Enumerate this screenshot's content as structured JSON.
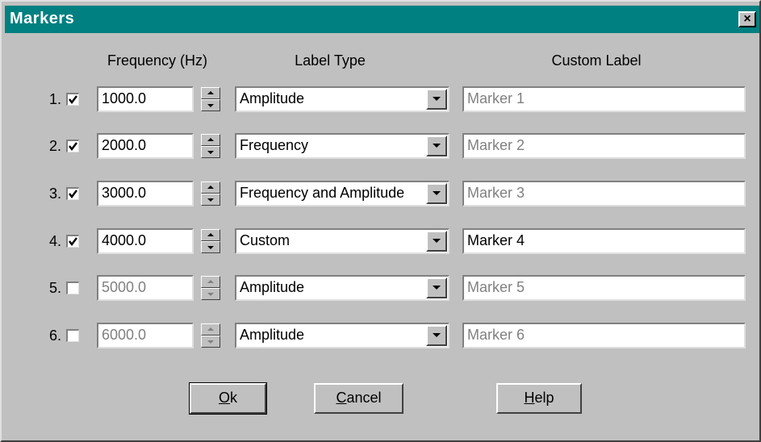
{
  "window": {
    "title": "Markers",
    "close_glyph": "×"
  },
  "columns": {
    "frequency": "Frequency (Hz)",
    "label_type": "Label Type",
    "custom_label": "Custom Label"
  },
  "rows": [
    {
      "number": "1.",
      "checked": true,
      "frequency": "1000.0",
      "label_type": "Amplitude",
      "custom_label": "Marker 1",
      "label_enabled": false,
      "freq_enabled": true
    },
    {
      "number": "2.",
      "checked": true,
      "frequency": "2000.0",
      "label_type": "Frequency",
      "custom_label": "Marker 2",
      "label_enabled": false,
      "freq_enabled": true
    },
    {
      "number": "3.",
      "checked": true,
      "frequency": "3000.0",
      "label_type": "Frequency and Amplitude",
      "custom_label": "Marker 3",
      "label_enabled": false,
      "freq_enabled": true
    },
    {
      "number": "4.",
      "checked": true,
      "frequency": "4000.0",
      "label_type": "Custom",
      "custom_label": "Marker 4",
      "label_enabled": true,
      "freq_enabled": true
    },
    {
      "number": "5.",
      "checked": false,
      "frequency": "5000.0",
      "label_type": "Amplitude",
      "custom_label": "Marker 5",
      "label_enabled": false,
      "freq_enabled": false
    },
    {
      "number": "6.",
      "checked": false,
      "frequency": "6000.0",
      "label_type": "Amplitude",
      "custom_label": "Marker 6",
      "label_enabled": false,
      "freq_enabled": false
    }
  ],
  "buttons": {
    "ok": {
      "mnemonic": "O",
      "rest": "k"
    },
    "cancel": {
      "mnemonic": "C",
      "rest": "ancel"
    },
    "help": {
      "mnemonic": "H",
      "rest": "elp"
    }
  },
  "colors": {
    "titlebar": "#008080",
    "dialog_face": "#c0c0c0",
    "disabled_text": "#808080"
  }
}
